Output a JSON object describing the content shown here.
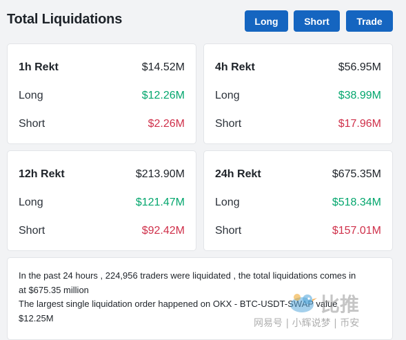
{
  "header": {
    "title": "Total Liquidations",
    "buttons": {
      "long": "Long",
      "short": "Short",
      "trade": "Trade"
    }
  },
  "cards": {
    "h1": {
      "title": "1h Rekt",
      "total": "$14.52M",
      "long_label": "Long",
      "long_value": "$12.26M",
      "short_label": "Short",
      "short_value": "$2.26M"
    },
    "h4": {
      "title": "4h Rekt",
      "total": "$56.95M",
      "long_label": "Long",
      "long_value": "$38.99M",
      "short_label": "Short",
      "short_value": "$17.96M"
    },
    "h12": {
      "title": "12h Rekt",
      "total": "$213.90M",
      "long_label": "Long",
      "long_value": "$121.47M",
      "short_label": "Short",
      "short_value": "$92.42M"
    },
    "h24": {
      "title": "24h Rekt",
      "total": "$675.35M",
      "long_label": "Long",
      "long_value": "$518.34M",
      "short_label": "Short",
      "short_value": "$157.01M"
    }
  },
  "summary": {
    "line1": "In the past 24 hours , 224,956 traders were liquidated , the total liquidations comes in",
    "line2": "at $675.35 million",
    "line3": "The largest single liquidation order happened on OKX - BTC-USDT-SWAP value",
    "line4": "$12.25M"
  },
  "watermark": {
    "logo_text": "比推",
    "caption": "网易号 | 小辉说梦 | 币安"
  },
  "colors": {
    "button_blue": "#1565c0",
    "positive_green": "#03a66d",
    "negative_red": "#cf304a"
  }
}
